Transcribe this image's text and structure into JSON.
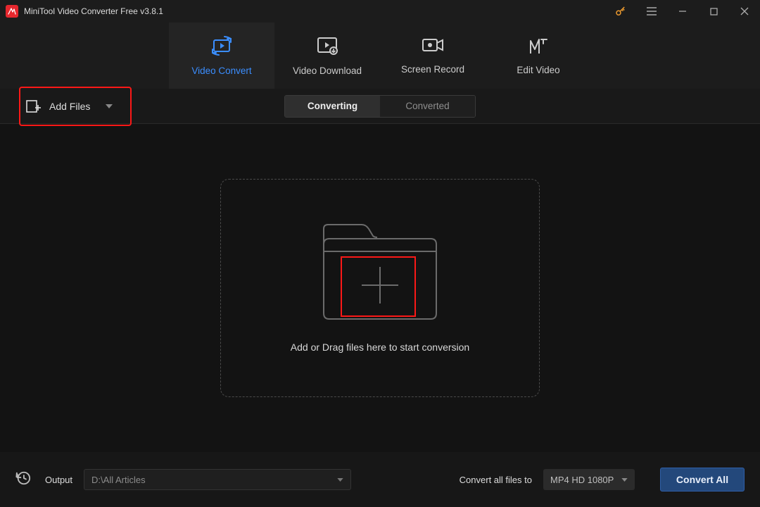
{
  "titlebar": {
    "title": "MiniTool Video Converter Free v3.8.1"
  },
  "nav": {
    "tabs": [
      {
        "label": "Video Convert"
      },
      {
        "label": "Video Download"
      },
      {
        "label": "Screen Record"
      },
      {
        "label": "Edit Video"
      }
    ]
  },
  "toolbar": {
    "add_files_label": "Add Files",
    "segments": [
      {
        "label": "Converting"
      },
      {
        "label": "Converted"
      }
    ]
  },
  "dropzone": {
    "text": "Add or Drag files here to start conversion"
  },
  "footer": {
    "output_label": "Output",
    "output_path": "D:\\All Articles",
    "convert_all_label": "Convert all files to",
    "format_value": "MP4 HD 1080P",
    "convert_all_button": "Convert All"
  }
}
